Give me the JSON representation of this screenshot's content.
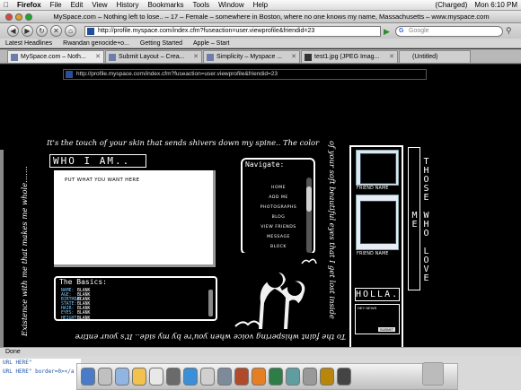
{
  "menubar": {
    "app": "Firefox",
    "items": [
      "File",
      "Edit",
      "View",
      "History",
      "Bookmarks",
      "Tools",
      "Window",
      "Help"
    ],
    "battery": "(Charged)",
    "clock": "Mon 6:10 PM"
  },
  "window": {
    "title": "MySpace.com – Nothing left to lose.. – 17 – Female – somewhere in Boston, where no one knows my name, Massachusetts – www.myspace.com"
  },
  "toolbar": {
    "url": "http://profile.myspace.com/index.cfm?fuseaction=user.viewprofile&friendid=23",
    "search_placeholder": "Google"
  },
  "bookmarks": [
    "Latest Headlines",
    "Rwandan genocide+o...",
    "Getting Started",
    "Apple – Start"
  ],
  "tabs": [
    {
      "label": "MySpace.com – Noth...",
      "active": true
    },
    {
      "label": "Submit Layout – Crea...",
      "active": false
    },
    {
      "label": "Simplicity – Myspace ...",
      "active": false
    },
    {
      "label": "test1.jpg (JPEG Imag...",
      "active": false
    },
    {
      "label": "(Untitled)",
      "active": false
    }
  ],
  "page": {
    "inner_url": "http://profile.myspace.com/index.cfm?fuseaction=user.viewprofile&friendid=23",
    "quote_top": "It's the touch of your skin that sends shivers down my spine.. The color",
    "quote_right": "of your soft beautiful eyes that I get lost inside",
    "quote_bottom": "To the faint whispering voice when you're by my side.. It's your entire",
    "quote_left": "Existence with me that makes me whole.......",
    "who_title": "WHO I AM..",
    "who_content": "PUT WHAT YOU WANT HERE",
    "basics_title": "The Basics:",
    "basics_rows": [
      {
        "k": "NAME:",
        "v": "BLANK"
      },
      {
        "k": "AGE:",
        "v": "BLANK"
      },
      {
        "k": "BIRTHDAY:",
        "v": "BLANK"
      },
      {
        "k": "STATE:",
        "v": "BLANK"
      },
      {
        "k": "HAIR:",
        "v": "BLANK"
      },
      {
        "k": "EYES:",
        "v": "BLANK"
      },
      {
        "k": "HEIGHT:",
        "v": "BLANK"
      }
    ],
    "nav_title": "Navigate:",
    "nav_items": [
      "HOME",
      "ADD ME",
      "PHOTOGRAPHS",
      "BLOG",
      "VIEW FRIENDS",
      "MESSAGE",
      "BLOCK"
    ],
    "friend_label_1": "FRIEND NAME",
    "friend_label_2": "FRIEND NAME",
    "those_who": "THOSE WHO LOVE ME",
    "holla_title": "HOLLA.",
    "holla_field": "HEY NEWS",
    "holla_button": "SUBMIT"
  },
  "status": "Done",
  "terminal": [
    "URL HERE\"",
    "URL HERE\" border=0></a"
  ]
}
